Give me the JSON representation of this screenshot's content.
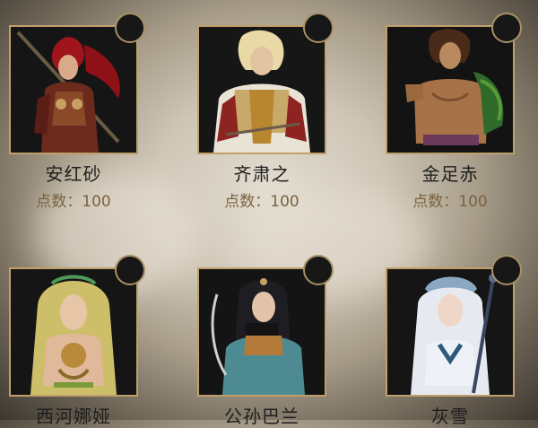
{
  "colors": {
    "frame": "#bfa06a",
    "name_text": "#1e1e1e",
    "points_text": "#7a6240"
  },
  "characters": [
    {
      "name": "安红砂",
      "points": "点数：100"
    },
    {
      "name": "齐肃之",
      "points": "点数：100"
    },
    {
      "name": "金足赤",
      "points": "点数：100"
    },
    {
      "name": "西河娜娅"
    },
    {
      "name": "公孙巴兰"
    },
    {
      "name": "灰雪"
    }
  ]
}
